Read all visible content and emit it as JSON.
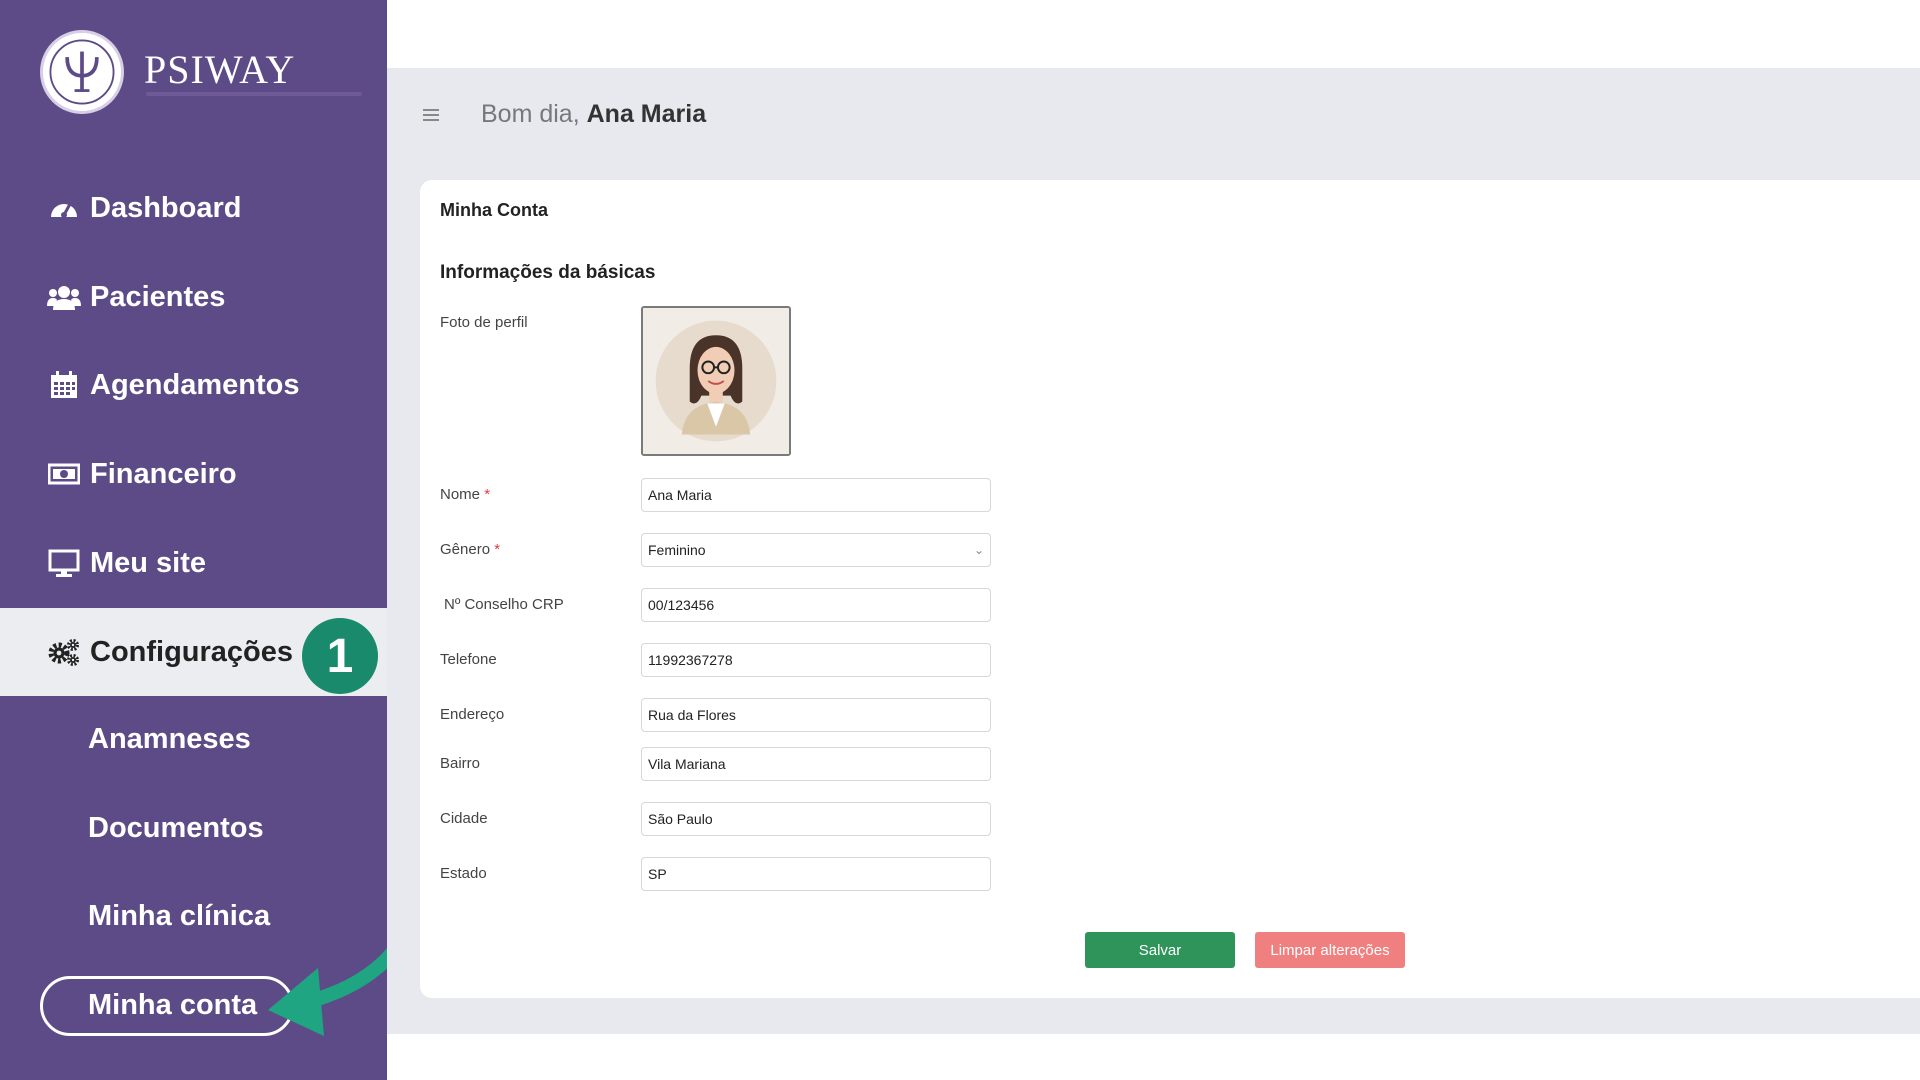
{
  "brand": {
    "name": "PSIWAY",
    "icon": "psi-logo-icon"
  },
  "header": {
    "greeting": "Bom dia,",
    "user_name": "Ana Maria",
    "menu_icon": "hamburger-icon"
  },
  "sidebar": {
    "items": [
      {
        "label": "Dashboard",
        "icon": "dashboard-icon"
      },
      {
        "label": "Pacientes",
        "icon": "users-icon"
      },
      {
        "label": "Agendamentos",
        "icon": "calendar-icon"
      },
      {
        "label": "Financeiro",
        "icon": "money-icon"
      },
      {
        "label": "Meu site",
        "icon": "monitor-icon"
      },
      {
        "label": "Configurações",
        "icon": "gears-icon",
        "active": true
      }
    ],
    "sub_items": [
      {
        "label": "Anamneses"
      },
      {
        "label": "Documentos"
      },
      {
        "label": "Minha clínica"
      },
      {
        "label": "Minha conta",
        "highlighted": true
      }
    ]
  },
  "annotation": {
    "step_badge": "1",
    "arrow_color": "#1fa582"
  },
  "card": {
    "title": "Minha Conta",
    "section_title": "Informações da básicas",
    "photo_label": "Foto de perfil",
    "fields": [
      {
        "label": "Nome",
        "required": "*",
        "value": "Ana Maria"
      },
      {
        "label": "Gênero",
        "required": "*",
        "value": "Feminino",
        "type": "select"
      },
      {
        "label": "Nº Conselho CRP",
        "value": "00/123456"
      },
      {
        "label": "Telefone",
        "value": "11992367278"
      },
      {
        "label": "Endereço",
        "value": "Rua da Flores"
      },
      {
        "label": "Bairro",
        "value": "Vila Mariana"
      },
      {
        "label": "Cidade",
        "value": "São Paulo"
      },
      {
        "label": "Estado",
        "value": "SP"
      }
    ],
    "save_label": "Salvar",
    "clear_label": "Limpar alterações"
  },
  "colors": {
    "sidebar_bg": "#5d4b87",
    "main_bg": "#e8e9ee",
    "save_button": "#2f9459",
    "clear_button": "#f08080",
    "badge": "#198a6b"
  }
}
